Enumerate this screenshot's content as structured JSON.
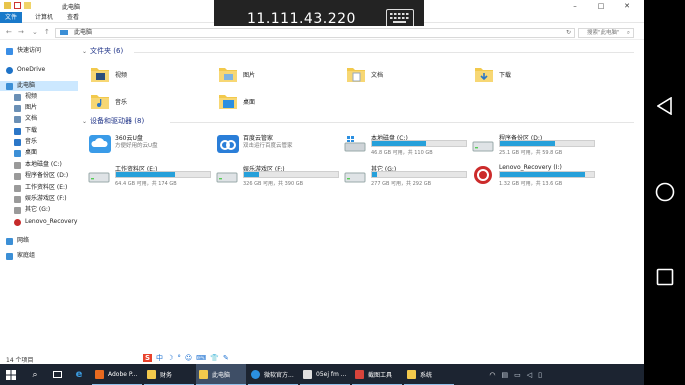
{
  "window": {
    "title": "此电脑",
    "controls": [
      "–",
      "□",
      "✕"
    ]
  },
  "ribbon": {
    "tabs": [
      {
        "label": "文件",
        "active": true
      },
      {
        "label": "计算机",
        "active": false
      },
      {
        "label": "查看",
        "active": false
      }
    ]
  },
  "overlay": {
    "ip": "11.111.43.220"
  },
  "address": {
    "path": "此电脑",
    "search_placeholder": "搜索\"此电脑\""
  },
  "sidebar": {
    "items": [
      {
        "label": "快速访问",
        "icon": "star-icon",
        "indent": 0,
        "selected": false
      },
      {
        "label": "OneDrive",
        "icon": "cloud-icon",
        "indent": 0,
        "selected": false
      },
      {
        "label": "此电脑",
        "icon": "computer-icon",
        "indent": 0,
        "selected": true
      },
      {
        "label": "视频",
        "icon": "video-folder-icon",
        "indent": 1,
        "selected": false
      },
      {
        "label": "图片",
        "icon": "pictures-folder-icon",
        "indent": 1,
        "selected": false
      },
      {
        "label": "文档",
        "icon": "documents-folder-icon",
        "indent": 1,
        "selected": false
      },
      {
        "label": "下载",
        "icon": "download-icon",
        "indent": 1,
        "selected": false
      },
      {
        "label": "音乐",
        "icon": "music-icon",
        "indent": 1,
        "selected": false
      },
      {
        "label": "桌面",
        "icon": "desktop-icon",
        "indent": 1,
        "selected": false
      },
      {
        "label": "本地磁盘 (C:)",
        "icon": "drive-icon",
        "indent": 1,
        "selected": false
      },
      {
        "label": "程序备份区 (D:)",
        "icon": "drive-icon",
        "indent": 1,
        "selected": false
      },
      {
        "label": "工作资料区 (E:)",
        "icon": "drive-icon",
        "indent": 1,
        "selected": false
      },
      {
        "label": "娱乐游戏区 (F:)",
        "icon": "drive-icon",
        "indent": 1,
        "selected": false
      },
      {
        "label": "其它 (G:)",
        "icon": "drive-icon",
        "indent": 1,
        "selected": false
      },
      {
        "label": "Lenovo_Recovery",
        "icon": "recovery-icon",
        "indent": 1,
        "selected": false
      },
      {
        "label": "网络",
        "icon": "network-icon",
        "indent": 0,
        "selected": false
      },
      {
        "label": "家庭组",
        "icon": "homegroup-icon",
        "indent": 0,
        "selected": false
      }
    ]
  },
  "folders": {
    "header": "文件夹 (6)",
    "items": [
      {
        "label": "视频",
        "icon": "video-folder-icon"
      },
      {
        "label": "图片",
        "icon": "pictures-folder-icon"
      },
      {
        "label": "文档",
        "icon": "documents-folder-icon"
      },
      {
        "label": "下载",
        "icon": "download-folder-icon"
      },
      {
        "label": "音乐",
        "icon": "music-folder-icon"
      },
      {
        "label": "桌面",
        "icon": "desktop-folder-icon"
      }
    ]
  },
  "devices": {
    "header": "设备和驱动器 (8)",
    "items": [
      {
        "name": "360云U盘",
        "sub": "方便好用的云U盘",
        "type": "app",
        "icon": "cloud-drive-icon"
      },
      {
        "name": "百度云管家",
        "sub": "双击运行百度云管家",
        "type": "app",
        "icon": "baidu-cloud-icon"
      },
      {
        "name": "本地磁盘 (C:)",
        "free": "46.8 GB 可用，共 110 GB",
        "used_fraction": 0.57,
        "type": "drive",
        "icon": "windows-drive-icon"
      },
      {
        "name": "程序备份区 (D:)",
        "free": "25.1 GB 可用，共 59.8 GB",
        "used_fraction": 0.58,
        "type": "drive",
        "icon": "hdd-icon"
      },
      {
        "name": "工作资料区 (E:)",
        "free": "64.4 GB 可用，共 174 GB",
        "used_fraction": 0.63,
        "type": "drive",
        "icon": "hdd-icon"
      },
      {
        "name": "娱乐游戏区 (F:)",
        "free": "326 GB 可用，共 390 GB",
        "used_fraction": 0.16,
        "type": "drive",
        "icon": "hdd-icon"
      },
      {
        "name": "其它 (G:)",
        "free": "277 GB 可用，共 292 GB",
        "used_fraction": 0.05,
        "type": "drive",
        "icon": "hdd-icon"
      },
      {
        "name": "Lenovo_Recovery (I:)",
        "free": "1.32 GB 可用，共 13.6 GB",
        "used_fraction": 0.9,
        "type": "drive",
        "icon": "recovery-drive-icon"
      }
    ]
  },
  "status": {
    "count": "14 个项目"
  },
  "taskbar": {
    "items": [
      {
        "label": "Adobe P...",
        "icon": "adobe-icon",
        "active": false
      },
      {
        "label": "财务",
        "icon": "folder-icon",
        "active": false
      },
      {
        "label": "此电脑",
        "icon": "explorer-icon",
        "active": true
      },
      {
        "label": "微软官方...",
        "icon": "browser-icon",
        "active": false
      },
      {
        "label": "05ej fm ...",
        "icon": "document-icon",
        "active": false
      },
      {
        "label": "截图工具",
        "icon": "snip-icon",
        "active": false
      },
      {
        "label": "系统",
        "icon": "folder-icon",
        "active": false
      }
    ],
    "ime_label": "中"
  },
  "colors": {
    "accent": "#1979ca",
    "bar_fill": "#26a0da",
    "selected_bg": "#cce8ff",
    "taskbar_bg": "#1c2431"
  }
}
